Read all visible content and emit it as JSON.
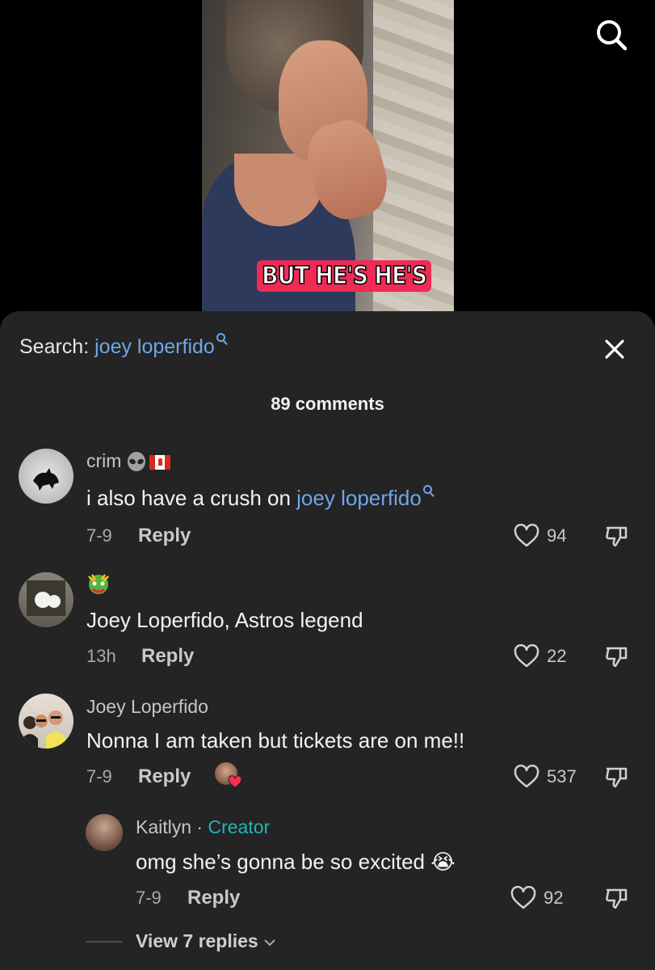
{
  "video": {
    "caption": "BUT HE'S HE'S"
  },
  "sheet": {
    "search_label": "Search: ",
    "search_query": "joey loperfido",
    "comment_count": "89 comments"
  },
  "comments": [
    {
      "username": "crim",
      "text_prefix": "i also have a crush on ",
      "text_link": "joey loperfido",
      "date": "7-9",
      "reply_label": "Reply",
      "likes": "94"
    },
    {
      "username": "",
      "text": "Joey Loperfido, Astros legend",
      "date": "13h",
      "reply_label": "Reply",
      "likes": "22"
    },
    {
      "username": "Joey Loperfido",
      "text": "Nonna I am taken but tickets are on me!!",
      "date": "7-9",
      "reply_label": "Reply",
      "likes": "537"
    }
  ],
  "reply": {
    "username": "Kaitlyn",
    "separator": " · ",
    "badge": "Creator",
    "text": "omg she’s gonna be so excited ",
    "emoji": "😭",
    "date": "7-9",
    "reply_label": "Reply",
    "likes": "92"
  },
  "view_replies": "View 7 replies",
  "colors": {
    "link": "#6ea6e8",
    "creator": "#20b5b9",
    "caption_bg": "#ef2a55",
    "sheet_bg": "#242424"
  },
  "icons": [
    "search-icon",
    "close-icon",
    "heart-icon",
    "dislike-icon",
    "chevron-down-icon"
  ]
}
